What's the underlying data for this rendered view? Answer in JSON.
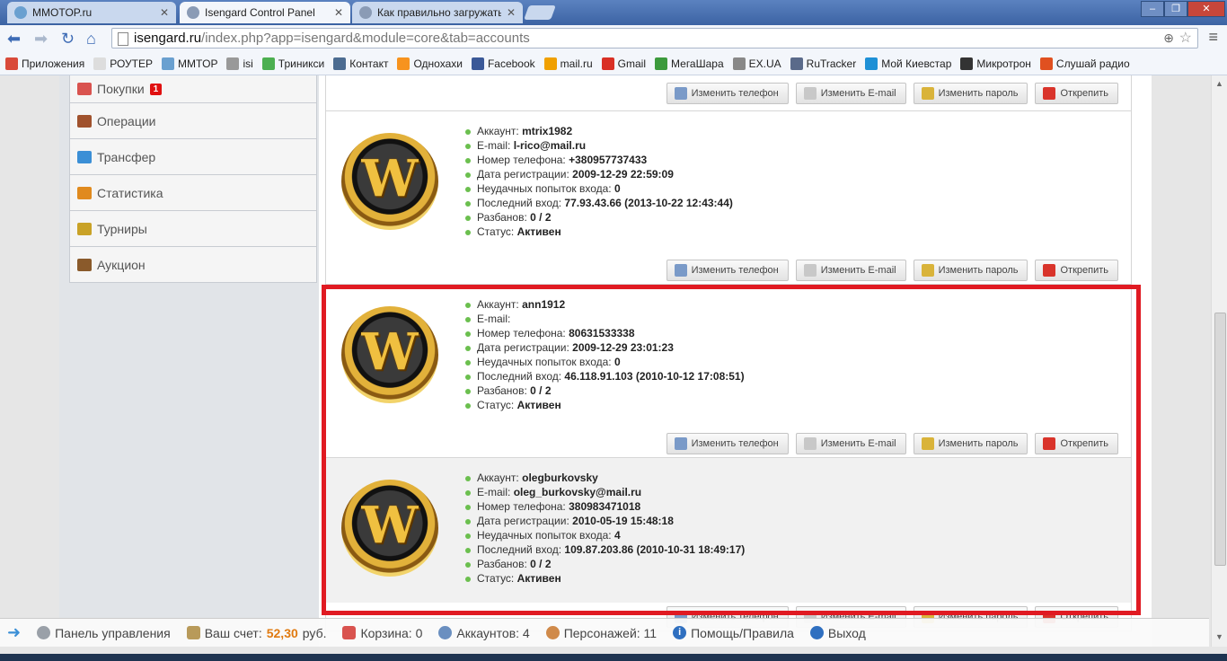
{
  "browser": {
    "tabs": [
      {
        "label": "MMOTOP.ru",
        "active": false
      },
      {
        "label": "Isengard Control Panel",
        "active": true
      },
      {
        "label": "Как правильно загружать",
        "active": false
      }
    ],
    "url_host": "isengard.ru",
    "url_path": "/index.php?app=isengard&module=core&tab=accounts",
    "bookmarks": [
      {
        "label": "Приложения",
        "icon": "apps-icon",
        "color": "#d94a3a"
      },
      {
        "label": "РОУТЕР",
        "icon": "page-icon",
        "color": "#dddddd"
      },
      {
        "label": "MMTOP",
        "icon": "mmtop-icon",
        "color": "#6aa0d0"
      },
      {
        "label": "isi",
        "icon": "isi-icon",
        "color": "#999999"
      },
      {
        "label": "Триникси",
        "icon": "triniksi-icon",
        "color": "#4caf50"
      },
      {
        "label": "Контакт",
        "icon": "vk-icon",
        "color": "#4c6c91"
      },
      {
        "label": "Однохахи",
        "icon": "ok-icon",
        "color": "#f7931e"
      },
      {
        "label": "Facebook",
        "icon": "facebook-icon",
        "color": "#3b5998"
      },
      {
        "label": "mail.ru",
        "icon": "mailru-icon",
        "color": "#f0a000"
      },
      {
        "label": "Gmail",
        "icon": "gmail-icon",
        "color": "#d93025"
      },
      {
        "label": "МегаШара",
        "icon": "megashara-icon",
        "color": "#3c9a3c"
      },
      {
        "label": "EX.UA",
        "icon": "exua-icon",
        "color": "#888888"
      },
      {
        "label": "RuTracker",
        "icon": "rutracker-icon",
        "color": "#5a6a8a"
      },
      {
        "label": "Мой Киевстар",
        "icon": "star-icon",
        "color": "#1e90d6"
      },
      {
        "label": "Микротрон",
        "icon": "mikrotron-icon",
        "color": "#333333"
      },
      {
        "label": "Слушай радио",
        "icon": "radio-icon",
        "color": "#e05020"
      }
    ]
  },
  "sidebar": {
    "items": [
      {
        "label": "Покупки",
        "badge": "1",
        "icon": "calendar-icon",
        "color": "#d9534f"
      },
      {
        "label": "Операции",
        "icon": "wallet-icon",
        "color": "#a0522d"
      },
      {
        "label": "Трансфер",
        "icon": "transfer-icon",
        "color": "#3b8fd6"
      },
      {
        "label": "Статистика",
        "icon": "chart-icon",
        "color": "#e08a1e"
      },
      {
        "label": "Турниры",
        "icon": "trophy-icon",
        "color": "#c9a227"
      },
      {
        "label": "Аукцион",
        "icon": "gavel-icon",
        "color": "#8a5a2b"
      }
    ]
  },
  "actions": {
    "change_phone": "Изменить телефон",
    "change_email": "Изменить E-mail",
    "change_password": "Изменить пароль",
    "unlink": "Открепить"
  },
  "labels": {
    "account": "Аккаунт:",
    "email": "E-mail:",
    "phone": "Номер телефона:",
    "reg_date": "Дата регистрации:",
    "failed_logins": "Неудачных попыток входа:",
    "last_login": "Последний вход:",
    "unbans": "Разбанов:",
    "status": "Статус:"
  },
  "accounts": [
    {
      "account": "mtrix1982",
      "email": "l-rico@mail.ru",
      "phone": "+380957737433",
      "reg_date": "2009-12-29 22:59:09",
      "failed_logins": "0",
      "last_login": "77.93.43.66 (2013-10-22 12:43:44)",
      "unbans": "0 / 2",
      "status": "Активен"
    },
    {
      "account": "ann1912",
      "email": "",
      "phone": "80631533338",
      "reg_date": "2009-12-29 23:01:23",
      "failed_logins": "0",
      "last_login": "46.118.91.103 (2010-10-12 17:08:51)",
      "unbans": "0 / 2",
      "status": "Активен"
    },
    {
      "account": "olegburkovsky",
      "email": "oleg_burkovsky@mail.ru",
      "phone": "380983471018",
      "reg_date": "2010-05-19 15:48:18",
      "failed_logins": "4",
      "last_login": "109.87.203.86 (2010-10-31 18:49:17)",
      "unbans": "0 / 2",
      "status": "Активен"
    }
  ],
  "logo_letter": "W",
  "statusbar": {
    "control_panel": "Панель управления",
    "balance_label": "Ваш счет:",
    "balance_value": "52,30",
    "currency": "руб.",
    "cart": "Корзина: 0",
    "accounts": "Аккаунтов: 4",
    "characters": "Персонажей: 11",
    "help": "Помощь/Правила",
    "logout": "Выход"
  },
  "colors": {
    "highlight": "#e01a22",
    "status_dot": "#6bbf4e",
    "balance": "#e07a10",
    "badge": "#e01010"
  }
}
